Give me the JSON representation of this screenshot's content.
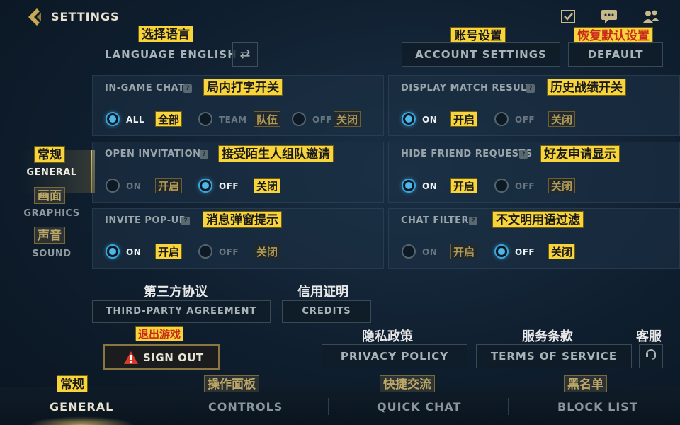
{
  "header": {
    "title": "SETTINGS",
    "icons": [
      "checklist-icon",
      "chat-icon",
      "friends-icon"
    ]
  },
  "language": {
    "label": "LANGUAGE ENGLISH",
    "tag_zh": "选择语言",
    "swap_symbol": "⇄"
  },
  "account": {
    "label": "ACCOUNT SETTINGS",
    "tag_zh": "账号设置"
  },
  "default": {
    "label": "DEFAULT",
    "tag_zh": "恢复默认设置"
  },
  "nav": {
    "general": {
      "label": "GENERAL",
      "zh": "常规"
    },
    "graphics": {
      "label": "GRAPHICS",
      "zh": "画面"
    },
    "sound": {
      "label": "SOUND",
      "zh": "声音"
    }
  },
  "panels": {
    "ingame_chat": {
      "title": "IN-GAME CHAT",
      "tag_zh": "局内打字开关",
      "opt_all": "ALL",
      "opt_all_zh": "全部",
      "opt_team": "TEAM",
      "opt_team_zh": "队伍",
      "opt_off": "OFF",
      "opt_off_zh": "关闭"
    },
    "display_match": {
      "title": "DISPLAY MATCH RESULT",
      "tag_zh": "历史战绩开关",
      "opt_on": "ON",
      "opt_on_zh": "开启",
      "opt_off": "OFF",
      "opt_off_zh": "关闭"
    },
    "open_invitation": {
      "title": "OPEN INVITATION",
      "tag_zh": "接受陌生人组队邀请",
      "opt_on": "ON",
      "opt_on_zh": "开启",
      "opt_off": "OFF",
      "opt_off_zh": "关闭"
    },
    "hide_friend": {
      "title": "HIDE FRIEND REQUESTS",
      "tag_zh": "好友申请显示",
      "opt_on": "ON",
      "opt_on_zh": "开启",
      "opt_off": "OFF",
      "opt_off_zh": "关闭"
    },
    "invite_popup": {
      "title": "INVITE POP-UP",
      "tag_zh": "消息弹窗提示",
      "opt_on": "ON",
      "opt_on_zh": "开启",
      "opt_off": "OFF",
      "opt_off_zh": "关闭"
    },
    "chat_filter": {
      "title": "CHAT FILTER",
      "tag_zh": "不文明用语过滤",
      "opt_on": "ON",
      "opt_on_zh": "开启",
      "opt_off": "OFF",
      "opt_off_zh": "关闭"
    }
  },
  "footer": {
    "third_party": {
      "label": "THIRD-PARTY AGREEMENT",
      "zh": "第三方协议"
    },
    "credits": {
      "label": "CREDITS",
      "zh": "信用证明"
    },
    "privacy": {
      "label": "PRIVACY POLICY",
      "zh": "隐私政策"
    },
    "terms": {
      "label": "TERMS OF SERVICE",
      "zh": "服务条款"
    },
    "support": {
      "zh": "客服"
    },
    "signout": {
      "label": "SIGN OUT",
      "zh": "退出游戏"
    }
  },
  "tabs": [
    {
      "label": "GENERAL",
      "zh": "常规"
    },
    {
      "label": "CONTROLS",
      "zh": "操作面板"
    },
    {
      "label": "QUICK CHAT",
      "zh": "快捷交流"
    },
    {
      "label": "BLOCK LIST",
      "zh": "黑名单"
    }
  ],
  "colors": {
    "accent": "#4fb6e8",
    "gold": "#c8a850",
    "tag": "#f7d33c"
  }
}
